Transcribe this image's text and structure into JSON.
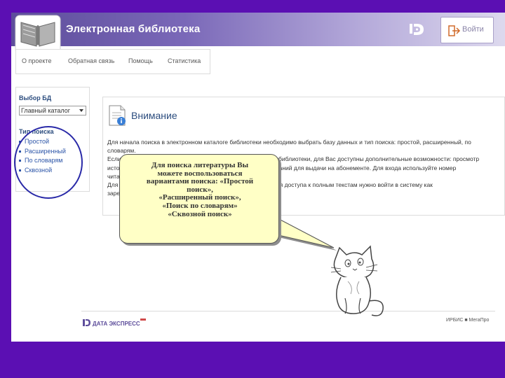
{
  "header": {
    "title": "Электронная библиотека",
    "login_label": "Войти"
  },
  "nav": {
    "items": [
      "О проекте",
      "Обратная связь",
      "Помощь",
      "Статистика"
    ]
  },
  "sidebar": {
    "db_title": "Выбор БД",
    "db_selected": "Главный каталог",
    "search_type_title": "Тип поиска",
    "search_types": [
      "Простой",
      "Расширенный",
      "По словарям",
      "Сквозной"
    ]
  },
  "main": {
    "title": "Внимание",
    "paragraphs": [
      "Для начала поиска в электронном каталоге библиотеки необходимо выбрать базу данных и тип поиска: простой, расширенный, по словарям.",
      "Если Вы являетесь зарегистрированным читателем Научной библиотеки, для Вас доступны дополнительные возможности: просмотр истории заказов, доступ к полным текстам изданий, заказ изданий для выдачи на абонементе. Для входа используйте номер читательского билета.",
      "Для некоторых изданий доступен полный текст. Для получения доступа к полным текстам нужно войти в систему как зарегистрированный читатель библиотеки."
    ]
  },
  "bubble": {
    "lines": [
      "Для поиска литературы Вы",
      "можете воспользоваться",
      "вариантами поиска: «Простой",
      "поиск»,",
      "«Расширенный поиск»,",
      "«Поиск по словарям»",
      "«Сквозной поиск»"
    ]
  },
  "footer": {
    "left_logo": "ДАТА ЭКСПРЕСС",
    "right_logo": "ИРБИС ■ МегаПро"
  },
  "colors": {
    "background": "#5b0fb3",
    "header_start": "#5d4d9b",
    "link": "#2c55a8",
    "heading": "#2b4c7e",
    "bubble": "#ffffc6",
    "annotation_circle": "#2a2aa8"
  }
}
